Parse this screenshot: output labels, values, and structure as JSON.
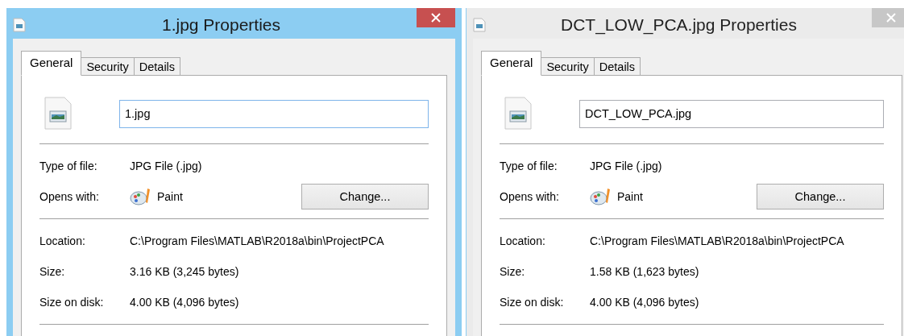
{
  "windows": [
    {
      "title": "1.jpg Properties",
      "active": true,
      "tabs": [
        {
          "label": "General",
          "selected": true
        },
        {
          "label": "Security",
          "selected": false
        },
        {
          "label": "Details",
          "selected": false
        }
      ],
      "file_name": "1.jpg",
      "type_of_file": {
        "label": "Type of file:",
        "value": "JPG File (.jpg)"
      },
      "opens_with": {
        "label": "Opens with:",
        "app": "Paint",
        "button": "Change..."
      },
      "details": [
        {
          "label": "Location:",
          "value": "C:\\Program Files\\MATLAB\\R2018a\\bin\\ProjectPCA"
        },
        {
          "label": "Size:",
          "value": "3.16 KB (3,245 bytes)"
        },
        {
          "label": "Size on disk:",
          "value": "4.00 KB (4,096 bytes)"
        }
      ]
    },
    {
      "title": "DCT_LOW_PCA.jpg Properties",
      "active": false,
      "tabs": [
        {
          "label": "General",
          "selected": true
        },
        {
          "label": "Security",
          "selected": false
        },
        {
          "label": "Details",
          "selected": false
        }
      ],
      "file_name": "DCT_LOW_PCA.jpg",
      "type_of_file": {
        "label": "Type of file:",
        "value": "JPG File (.jpg)"
      },
      "opens_with": {
        "label": "Opens with:",
        "app": "Paint",
        "button": "Change..."
      },
      "details": [
        {
          "label": "Location:",
          "value": "C:\\Program Files\\MATLAB\\R2018a\\bin\\ProjectPCA"
        },
        {
          "label": "Size:",
          "value": "1.58 KB (1,623 bytes)"
        },
        {
          "label": "Size on disk:",
          "value": "4.00 KB (4,096 bytes)"
        }
      ]
    }
  ]
}
